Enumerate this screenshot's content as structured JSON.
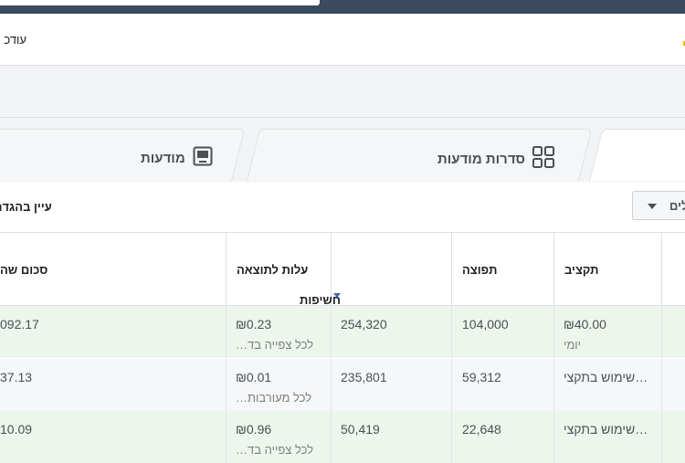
{
  "notice": {
    "text": "עודכ"
  },
  "tabs": {
    "ads_label": "מודעות",
    "adsets_label": "סדרות מודעות",
    "ads_icon": "ad-screen-icon",
    "adsets_icon": "grid-squares-icon"
  },
  "toolbar": {
    "view_settings": "עיין בהגדר",
    "dropdown_label": "לים"
  },
  "table": {
    "headers": {
      "amount_spent": "סכום שה",
      "cost_per_result": "עלות לתוצאה",
      "impressions": "חשיפות",
      "reach": "תפוצה",
      "budget": "תקציב"
    },
    "rows": [
      {
        "amount_spent": "092.17",
        "cost": "₪0.23",
        "cost_sub": "לכל צפייה בד…",
        "impressions": "254,320",
        "reach": "104,000",
        "budget": "₪40.00",
        "budget_sub": "יומי"
      },
      {
        "amount_spent": "37.13",
        "cost": "₪0.01",
        "cost_sub": "לכל מעורבות…",
        "impressions": "235,801",
        "reach": "59,312",
        "budget": "שימוש בתקצי…",
        "budget_sub": ""
      },
      {
        "amount_spent": "10.09",
        "cost": "₪0.96",
        "cost_sub": "לכל צפייה בד…",
        "impressions": "50,419",
        "reach": "22,648",
        "budget": "שימוש בתקצי…",
        "budget_sub": ""
      }
    ]
  },
  "colors": {
    "accent": "#4267b2",
    "row_highlight": "#edf6ec",
    "topbar": "#3b4a5e"
  }
}
